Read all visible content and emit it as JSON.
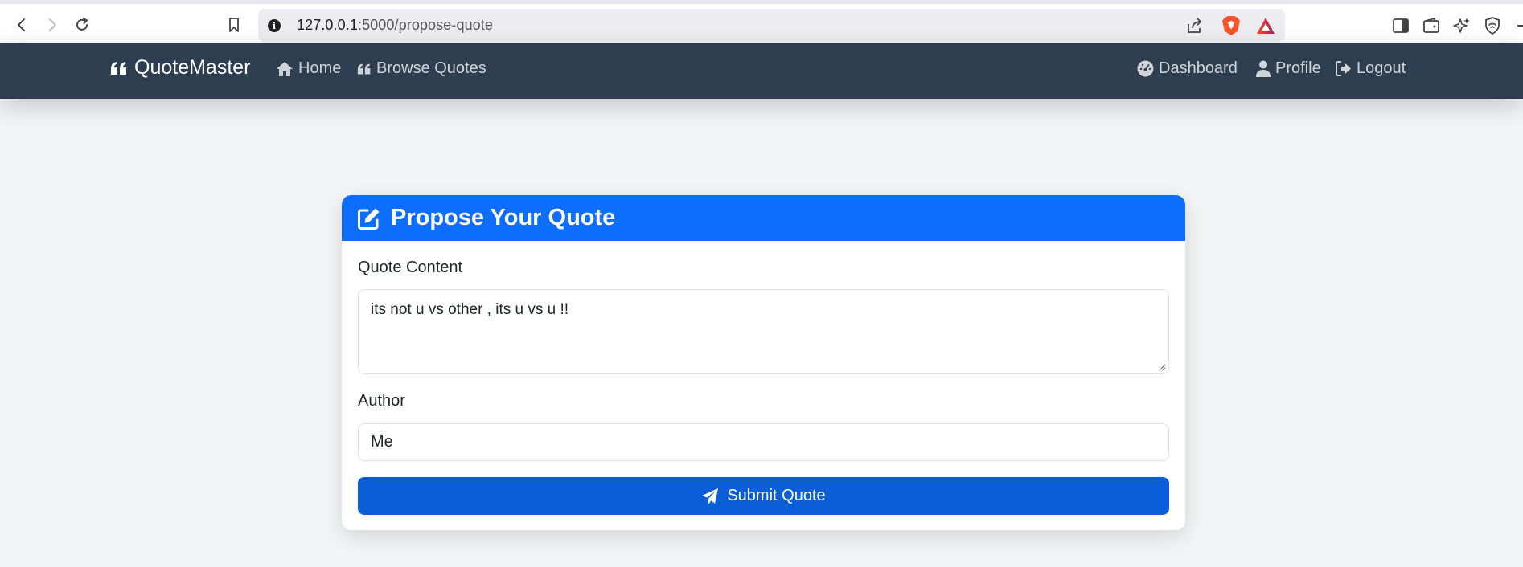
{
  "browser": {
    "url_host": "127.0.0.1",
    "url_path": ":5000/propose-quote",
    "icons": [
      "back-icon",
      "forward-icon",
      "reload-icon",
      "bookmark-icon",
      "site-info-icon",
      "share-icon",
      "brave-shield-icon",
      "brave-rewards-icon",
      "sidebar-icon",
      "wallet-icon",
      "leo-ai-icon",
      "vpn-icon"
    ]
  },
  "navbar": {
    "brand": "QuoteMaster",
    "links_left": [
      {
        "label": "Home",
        "icon": "home-icon"
      },
      {
        "label": "Browse Quotes",
        "icon": "quote-icon"
      }
    ],
    "links_right": [
      {
        "label": "Dashboard",
        "icon": "dashboard-icon"
      },
      {
        "label": "Profile",
        "icon": "user-icon"
      },
      {
        "label": "Logout",
        "icon": "logout-icon"
      }
    ]
  },
  "form": {
    "title": "Propose Your Quote",
    "title_icon": "edit-icon",
    "content_label": "Quote Content",
    "content_value": "its not u vs other , its u vs u !!",
    "author_label": "Author",
    "author_value": "Me",
    "submit_label": "Submit Quote",
    "submit_icon": "paper-plane-icon"
  },
  "colors": {
    "navbar": "#2c3e50",
    "header": "#0d6efd",
    "button": "#0b5ed7",
    "background": "#f3f4f6"
  }
}
